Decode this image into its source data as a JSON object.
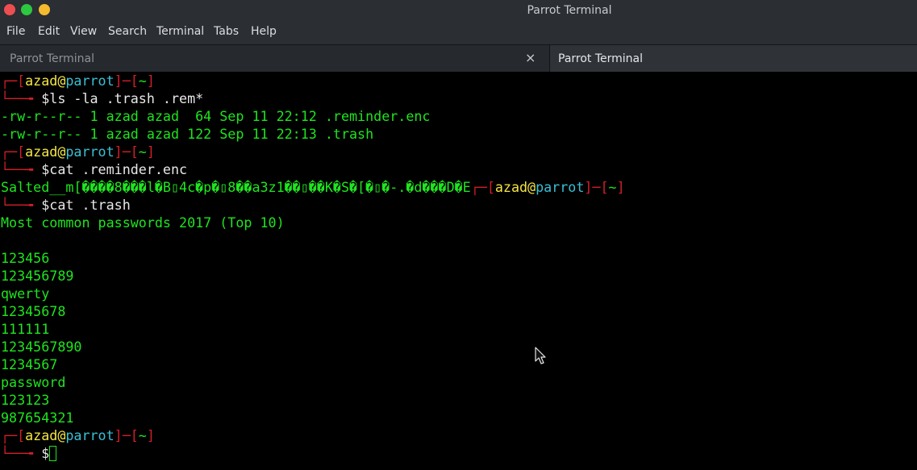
{
  "window": {
    "title": "Parrot Terminal"
  },
  "menu": [
    "File",
    "Edit",
    "View",
    "Search",
    "Terminal",
    "Tabs",
    "Help"
  ],
  "tabs": [
    {
      "label": "Parrot Terminal",
      "close": "×"
    },
    {
      "label": "Parrot Terminal"
    }
  ],
  "prompt": {
    "corner": "┌─",
    "open": "[",
    "user": "azad",
    "at": "@",
    "host": "parrot",
    "close": "]",
    "dash": "─",
    "dir_open": "[",
    "dir": "~",
    "dir_close": "]",
    "arrow": "└──╼ ",
    "sign": "$"
  },
  "terminal": {
    "cmd1": "ls -la .trash .rem*",
    "ls_out": [
      "-rw-r--r-- 1 azad azad  64 Sep 11 22:12 .reminder.enc",
      "-rw-r--r-- 1 azad azad 122 Sep 11 22:13 .trash"
    ],
    "cmd2": "cat .reminder.enc",
    "cat_enc_out": "Salted__m[����8���l�B▯4c�p�▯8��a3z1��▯��K�S�[�▯�-.�d���D�E",
    "cmd3": "cat .trash",
    "trash_header": "Most common passwords 2017 (Top 10)",
    "passwords": [
      "123456",
      "123456789",
      "qwerty",
      "12345678",
      "111111",
      "1234567890",
      "1234567",
      "password",
      "123123",
      "987654321"
    ]
  },
  "colors": {
    "prompt_red": "#d21f2a",
    "user_yellow": "#f4e542",
    "host_cyan": "#39c0d4",
    "output_green": "#1ee51e"
  },
  "icons": {
    "window_controls": [
      "close-icon",
      "maximize-icon",
      "minimize-icon"
    ],
    "pointer": "mouse-pointer-icon"
  }
}
